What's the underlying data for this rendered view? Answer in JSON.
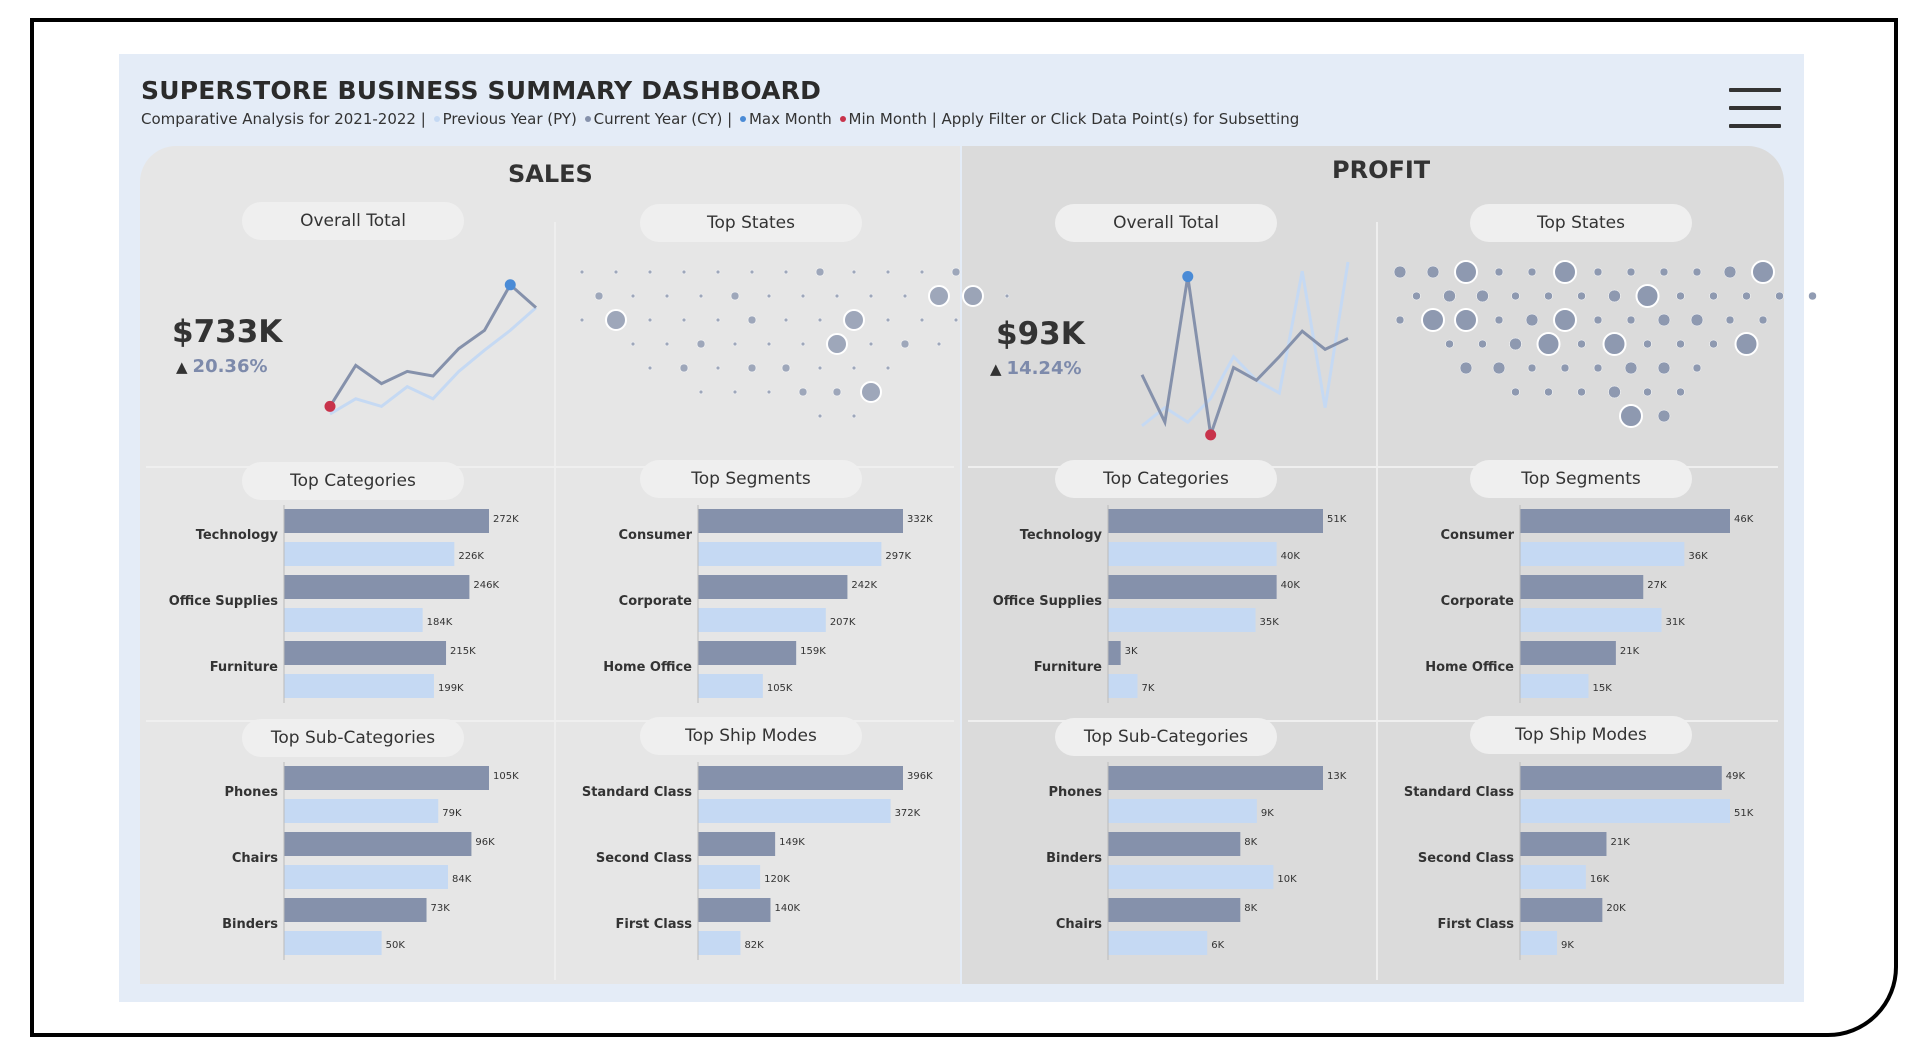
{
  "header": {
    "title": "SUPERSTORE BUSINESS SUMMARY DASHBOARD",
    "subtitle_parts": [
      "Comparative Analysis for 2021-2022 |",
      "Previous Year (PY)",
      "Current Year (CY) |",
      "Max Month",
      "Min Month | Apply Filter or Click Data Point(s) for Subsetting"
    ],
    "menu_icon": "hamburger-menu-icon"
  },
  "colors": {
    "cy": "#8591ab",
    "py": "#c5d9f3",
    "max": "#4a8bd6",
    "min": "#c8334b",
    "bg": "#e4ecf7"
  },
  "sales": {
    "section_title": "SALES",
    "overall_label": "Overall Total",
    "kpi_value": "$733K",
    "kpi_change": "20.36%",
    "states_label": "Top States",
    "categories": {
      "label": "Top Categories",
      "items": [
        {
          "name": "Technology",
          "cy": 272,
          "py": 226,
          "cy_label": "272K",
          "py_label": "226K"
        },
        {
          "name": "Office Supplies",
          "cy": 246,
          "py": 184,
          "cy_label": "246K",
          "py_label": "184K"
        },
        {
          "name": "Furniture",
          "cy": 215,
          "py": 199,
          "cy_label": "215K",
          "py_label": "199K"
        }
      ]
    },
    "segments": {
      "label": "Top Segments",
      "items": [
        {
          "name": "Consumer",
          "cy": 332,
          "py": 297,
          "cy_label": "332K",
          "py_label": "297K"
        },
        {
          "name": "Corporate",
          "cy": 242,
          "py": 207,
          "cy_label": "242K",
          "py_label": "207K"
        },
        {
          "name": "Home Office",
          "cy": 159,
          "py": 105,
          "cy_label": "159K",
          "py_label": "105K"
        }
      ]
    },
    "subcategories": {
      "label": "Top Sub-Categories",
      "items": [
        {
          "name": "Phones",
          "cy": 105,
          "py": 79,
          "cy_label": "105K",
          "py_label": "79K"
        },
        {
          "name": "Chairs",
          "cy": 96,
          "py": 84,
          "cy_label": "96K",
          "py_label": "84K"
        },
        {
          "name": "Binders",
          "cy": 73,
          "py": 50,
          "cy_label": "73K",
          "py_label": "50K"
        }
      ]
    },
    "shipmodes": {
      "label": "Top Ship Modes",
      "items": [
        {
          "name": "Standard Class",
          "cy": 396,
          "py": 372,
          "cy_label": "396K",
          "py_label": "372K"
        },
        {
          "name": "Second Class",
          "cy": 149,
          "py": 120,
          "cy_label": "149K",
          "py_label": "120K"
        },
        {
          "name": "First Class",
          "cy": 140,
          "py": 82,
          "cy_label": "140K",
          "py_label": "82K"
        }
      ]
    }
  },
  "profit": {
    "section_title": "PROFIT",
    "overall_label": "Overall Total",
    "kpi_value": "$93K",
    "kpi_change": "14.24%",
    "states_label": "Top States",
    "categories": {
      "label": "Top Categories",
      "items": [
        {
          "name": "Technology",
          "cy": 51,
          "py": 40,
          "cy_label": "51K",
          "py_label": "40K"
        },
        {
          "name": "Office Supplies",
          "cy": 40,
          "py": 35,
          "cy_label": "40K",
          "py_label": "35K"
        },
        {
          "name": "Furniture",
          "cy": 3,
          "py": 7,
          "cy_label": "3K",
          "py_label": "7K"
        }
      ]
    },
    "segments": {
      "label": "Top Segments",
      "items": [
        {
          "name": "Consumer",
          "cy": 46,
          "py": 36,
          "cy_label": "46K",
          "py_label": "36K"
        },
        {
          "name": "Corporate",
          "cy": 27,
          "py": 31,
          "cy_label": "27K",
          "py_label": "31K"
        },
        {
          "name": "Home Office",
          "cy": 21,
          "py": 15,
          "cy_label": "21K",
          "py_label": "15K"
        }
      ]
    },
    "subcategories": {
      "label": "Top Sub-Categories",
      "items": [
        {
          "name": "Phones",
          "cy": 13,
          "py": 9,
          "cy_label": "13K",
          "py_label": "9K"
        },
        {
          "name": "Binders",
          "cy": 8,
          "py": 10,
          "cy_label": "8K",
          "py_label": "10K"
        },
        {
          "name": "Chairs",
          "cy": 8,
          "py": 6,
          "cy_label": "8K",
          "py_label": "6K"
        }
      ]
    },
    "shipmodes": {
      "label": "Top Ship Modes",
      "items": [
        {
          "name": "Standard Class",
          "cy": 49,
          "py": 51,
          "cy_label": "49K",
          "py_label": "51K"
        },
        {
          "name": "Second Class",
          "cy": 21,
          "py": 16,
          "cy_label": "21K",
          "py_label": "16K"
        },
        {
          "name": "First Class",
          "cy": 20,
          "py": 9,
          "cy_label": "20K",
          "py_label": "9K"
        }
      ]
    }
  },
  "chart_data": [
    {
      "type": "line",
      "name": "sales-trend",
      "series": [
        {
          "values": [
            0.05,
            0.32,
            0.2,
            0.28,
            0.25,
            0.43,
            0.55,
            0.85,
            0.7
          ]
        },
        {
          "values": [
            0.0,
            0.1,
            0.05,
            0.18,
            0.1,
            0.28,
            0.42,
            0.55,
            0.7
          ]
        }
      ],
      "max_index": 7,
      "min_index": 0
    },
    {
      "type": "line",
      "name": "profit-trend",
      "series": [
        {
          "values": [
            0.38,
            0.12,
            0.92,
            0.05,
            0.42,
            0.35,
            0.48,
            0.62,
            0.52,
            0.58
          ]
        },
        {
          "values": [
            0.1,
            0.2,
            0.12,
            0.25,
            0.48,
            0.35,
            0.28,
            0.95,
            0.2,
            1.0
          ]
        }
      ],
      "max_index": 2,
      "min_index": 3
    },
    {
      "type": "bar",
      "name": "sales-top-categories",
      "categories": [
        "Technology",
        "Office Supplies",
        "Furniture"
      ],
      "series": [
        {
          "values": [
            272,
            246,
            215
          ]
        },
        {
          "values": [
            226,
            184,
            199
          ]
        }
      ]
    },
    {
      "type": "bar",
      "name": "profit-top-categories",
      "categories": [
        "Technology",
        "Office Supplies",
        "Furniture"
      ],
      "series": [
        {
          "values": [
            51,
            40,
            3
          ]
        },
        {
          "values": [
            40,
            35,
            7
          ]
        }
      ]
    }
  ]
}
